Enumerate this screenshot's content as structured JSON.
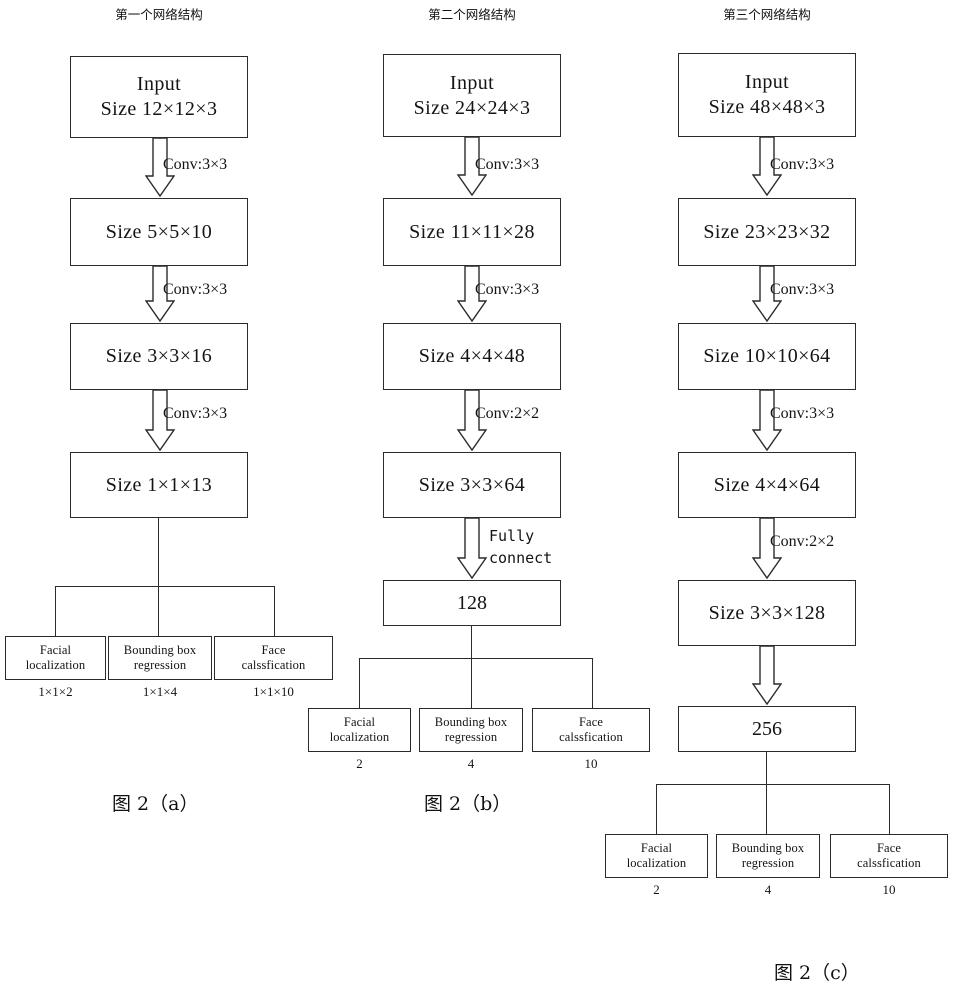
{
  "figure": {
    "title_a": "图 2（a）",
    "title_b": "图 2（b）",
    "title_c": "图 2（c）",
    "line_color": "#2b2b2b"
  },
  "columns": [
    {
      "id": "net1",
      "header": "第一个网络结构",
      "caption": "图 2（a）",
      "chain": [
        {
          "name": "input",
          "line1": "Input",
          "line2": "Size 12×12×3"
        },
        {
          "name": "conv1-out",
          "line1": "Size 5×5×10",
          "line2": ""
        },
        {
          "name": "conv2-out",
          "line1": "Size 3×3×16",
          "line2": ""
        },
        {
          "name": "conv3-out",
          "line1": "Size 1×1×13",
          "line2": ""
        }
      ],
      "arrows": [
        {
          "label": "Conv:3×3"
        },
        {
          "label": "Conv:3×3"
        },
        {
          "label": "Conv:3×3"
        }
      ],
      "outputs": [
        {
          "line1": "Facial",
          "line2": "localization",
          "dim": "1×1×2"
        },
        {
          "line1": "Bounding box",
          "line2": "regression",
          "dim": "1×1×4"
        },
        {
          "line1": "Face",
          "line2": "calssfication",
          "dim": "1×1×10"
        }
      ]
    },
    {
      "id": "net2",
      "header": "第二个网络结构",
      "caption": "图 2（b）",
      "chain": [
        {
          "name": "input",
          "line1": "Input",
          "line2": "Size 24×24×3"
        },
        {
          "name": "conv1-out",
          "line1": "Size 11×11×28",
          "line2": ""
        },
        {
          "name": "conv2-out",
          "line1": "Size 4×4×48",
          "line2": ""
        },
        {
          "name": "conv3-out",
          "line1": "Size 3×3×64",
          "line2": ""
        },
        {
          "name": "fc-out",
          "line1": "128",
          "line2": ""
        }
      ],
      "arrows": [
        {
          "label": "Conv:3×3"
        },
        {
          "label": "Conv:3×3"
        },
        {
          "label": "Conv:2×2"
        },
        {
          "label": "Fully\nconnect"
        }
      ],
      "outputs": [
        {
          "line1": "Facial",
          "line2": "localization",
          "dim": "2"
        },
        {
          "line1": "Bounding box",
          "line2": "regression",
          "dim": "4"
        },
        {
          "line1": "Face",
          "line2": "calssfication",
          "dim": "10"
        }
      ]
    },
    {
      "id": "net3",
      "header": "第三个网络结构",
      "caption": "图 2（c）",
      "chain": [
        {
          "name": "input",
          "line1": "Input",
          "line2": "Size 48×48×3"
        },
        {
          "name": "conv1-out",
          "line1": "Size 23×23×32",
          "line2": ""
        },
        {
          "name": "conv2-out",
          "line1": "Size 10×10×64",
          "line2": ""
        },
        {
          "name": "conv3-out",
          "line1": "Size 4×4×64",
          "line2": ""
        },
        {
          "name": "conv4-out",
          "line1": "Size 3×3×128",
          "line2": ""
        },
        {
          "name": "fc-out",
          "line1": "256",
          "line2": ""
        }
      ],
      "arrows": [
        {
          "label": "Conv:3×3"
        },
        {
          "label": "Conv:3×3"
        },
        {
          "label": "Conv:3×3"
        },
        {
          "label": "Conv:2×2"
        },
        {
          "label": ""
        }
      ],
      "outputs": [
        {
          "line1": "Facial",
          "line2": "localization",
          "dim": "2"
        },
        {
          "line1": "Bounding box",
          "line2": "regression",
          "dim": "4"
        },
        {
          "line1": "Face",
          "line2": "calssfication",
          "dim": "10"
        }
      ]
    }
  ]
}
